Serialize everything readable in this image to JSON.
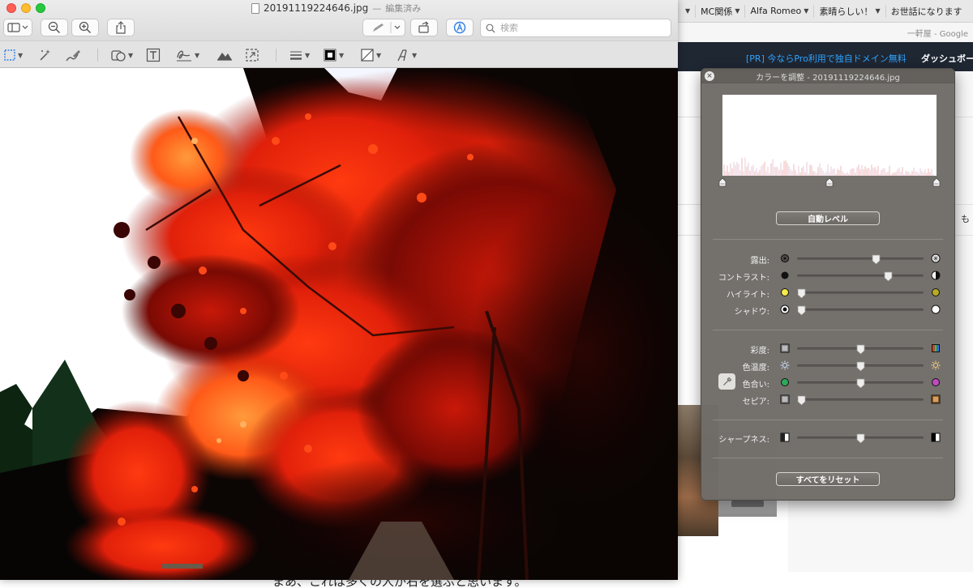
{
  "browser": {
    "bookmarks": [
      {
        "label": "MC関係"
      },
      {
        "label": "Alfa Romeo"
      },
      {
        "label": "素晴らしい！"
      },
      {
        "label": "お世話になります"
      }
    ],
    "search_hint": "一軒屋 - Google",
    "ad_text": "[PR] 今ならPro利用で独自ドメイン無料",
    "dashboard_label": "ダッシュボー",
    "side_text": "も",
    "caption": "まあ、これは多くの人が右を選ぶと思います。"
  },
  "preview": {
    "file_name": "20191119224646.jpg",
    "separator": "—",
    "edited_label": "編集済み",
    "search_placeholder": "検索"
  },
  "adjust_color": {
    "title": "カラーを調整 - 20191119224646.jpg",
    "close_glyph": "×",
    "auto_level_label": "自動レベル",
    "reset_all_label": "すべてをリセット",
    "sliders": [
      {
        "label": "露出:",
        "value": 0.62
      },
      {
        "label": "コントラスト:",
        "value": 0.72
      },
      {
        "label": "ハイライト:",
        "value": 0.03
      },
      {
        "label": "シャドウ:",
        "value": 0.03
      },
      {
        "label": "彩度:",
        "value": 0.5
      },
      {
        "label": "色温度:",
        "value": 0.5
      },
      {
        "label": "色合い:",
        "value": 0.5
      },
      {
        "label": "セピア:",
        "value": 0.03
      },
      {
        "label": "シャープネス:",
        "value": 0.5
      }
    ],
    "levels_markers": [
      0.0,
      0.5,
      1.0
    ]
  },
  "colors": {
    "accent_link": "#2fa4ff",
    "panel_bg": "#706c68",
    "close_red": "#fe5f57",
    "minimize_yellow": "#febc2e",
    "zoom_green": "#28c840"
  },
  "icons": [
    "sidebar-icon",
    "zoom-out-icon",
    "zoom-in-icon",
    "share-icon",
    "markup-pen-icon",
    "rotate-icon",
    "markup-toolbar-icon",
    "search-icon",
    "rect-selection-icon",
    "instant-alpha-icon",
    "sketch-icon",
    "shapes-icon",
    "text-icon",
    "sign-icon",
    "adjust-color-icon",
    "adjust-size-icon",
    "line-style-icon",
    "border-color-icon",
    "fill-color-icon",
    "text-style-icon",
    "eyedropper-icon"
  ]
}
